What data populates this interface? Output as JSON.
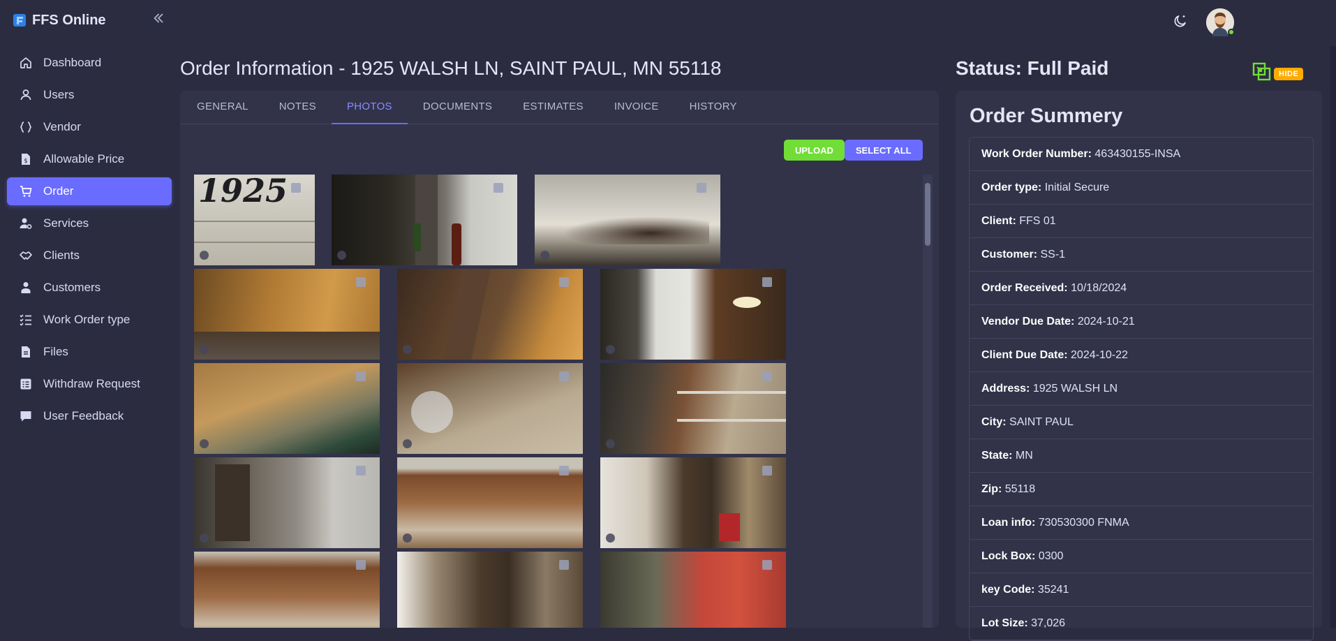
{
  "app": {
    "brand_name": "FFS Online",
    "collapse_icon": "double-chevron-left-icon"
  },
  "sidebar": {
    "items": [
      {
        "label": "Dashboard",
        "icon": "home-icon",
        "active": false
      },
      {
        "label": "Users",
        "icon": "user-icon",
        "active": false
      },
      {
        "label": "Vendor",
        "icon": "braces-icon",
        "active": false
      },
      {
        "label": "Allowable Price",
        "icon": "file-dollar-icon",
        "active": false
      },
      {
        "label": "Order",
        "icon": "cart-icon",
        "active": true
      },
      {
        "label": "Services",
        "icon": "user-cog-icon",
        "active": false
      },
      {
        "label": "Clients",
        "icon": "handshake-icon",
        "active": false
      },
      {
        "label": "Customers",
        "icon": "customer-icon",
        "active": false
      },
      {
        "label": "Work Order type",
        "icon": "checklist-icon",
        "active": false
      },
      {
        "label": "Files",
        "icon": "file-icon",
        "active": false
      },
      {
        "label": "Withdraw Request",
        "icon": "receipt-icon",
        "active": false
      },
      {
        "label": "User Feedback",
        "icon": "chat-icon",
        "active": false
      }
    ]
  },
  "header": {
    "theme_icon": "moon-icon",
    "avatar_status": "online"
  },
  "page": {
    "title": "Order Information - 1925 WALSH LN, SAINT PAUL, MN 55118",
    "status": "Status: Full Paid",
    "hide_label": "HIDE"
  },
  "tabs": [
    {
      "label": "GENERAL",
      "active": false
    },
    {
      "label": "NOTES",
      "active": false
    },
    {
      "label": "PHOTOS",
      "active": true
    },
    {
      "label": "DOCUMENTS",
      "active": false
    },
    {
      "label": "ESTIMATES",
      "active": false
    },
    {
      "label": "INVOICE",
      "active": false
    },
    {
      "label": "HISTORY",
      "active": false
    }
  ],
  "photos_toolbar": {
    "upload_label": "UPLOAD",
    "select_all_label": "SELECT ALL"
  },
  "photos": [
    {
      "caption": "1925"
    },
    {
      "caption": ""
    },
    {
      "caption": ""
    },
    {
      "caption": ""
    },
    {
      "caption": ""
    },
    {
      "caption": ""
    },
    {
      "caption": ""
    },
    {
      "caption": ""
    },
    {
      "caption": ""
    },
    {
      "caption": ""
    },
    {
      "caption": ""
    },
    {
      "caption": ""
    },
    {
      "caption": ""
    },
    {
      "caption": ""
    },
    {
      "caption": ""
    }
  ],
  "summary": {
    "title": "Order Summery",
    "rows": [
      {
        "label": "Work Order Number",
        "value": "463430155-INSA"
      },
      {
        "label": "Order type",
        "value": "Initial Secure"
      },
      {
        "label": "Client",
        "value": "FFS 01"
      },
      {
        "label": "Customer",
        "value": "SS-1"
      },
      {
        "label": "Order Received",
        "value": "10/18/2024"
      },
      {
        "label": "Vendor Due Date",
        "value": "2024-10-21"
      },
      {
        "label": "Client Due Date",
        "value": "2024-10-22"
      },
      {
        "label": "Address",
        "value": "1925 WALSH LN"
      },
      {
        "label": "City",
        "value": "SAINT PAUL"
      },
      {
        "label": "State",
        "value": "MN"
      },
      {
        "label": "Zip",
        "value": "55118"
      },
      {
        "label": "Loan info",
        "value": "730530300 FNMA"
      },
      {
        "label": "Lock Box",
        "value": "0300"
      },
      {
        "label": "key Code",
        "value": "35241"
      },
      {
        "label": "Lot Size",
        "value": "37,026"
      }
    ]
  },
  "colors": {
    "background": "#2b2c40",
    "card": "#323349",
    "primary": "#696cff",
    "success": "#71dd37",
    "warning": "#ffab00"
  }
}
